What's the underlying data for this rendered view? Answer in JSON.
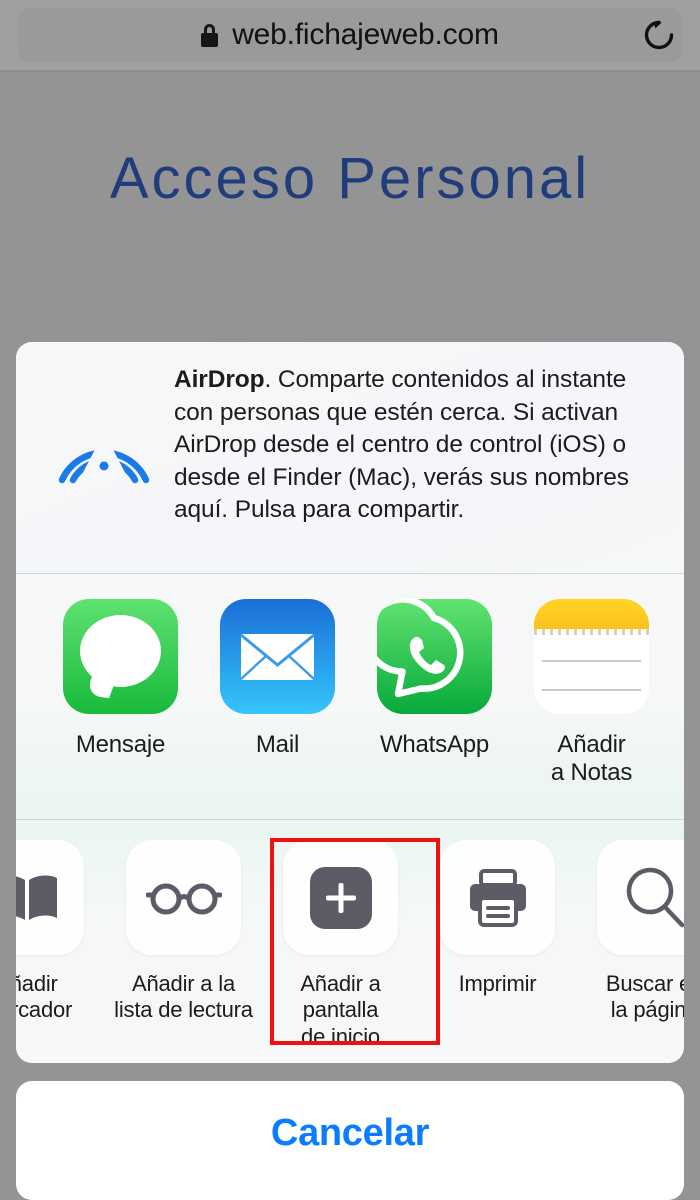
{
  "browser": {
    "url": "web.fichajeweb.com",
    "lock_icon": "lock-icon",
    "reload_icon": "reload-icon"
  },
  "page": {
    "title": "Acceso Personal",
    "title_color": "#1f3d7a",
    "backdrop_color": "#949494"
  },
  "share_sheet": {
    "airdrop": {
      "icon": "airdrop-icon",
      "icon_color": "#1a7ae8",
      "title": "AirDrop",
      "body": ". Comparte contenidos al instante con personas que estén cerca. Si activan AirDrop desde el centro de control (iOS) o desde el Finder (Mac), verás sus nombres aquí. Pulsa para compartir."
    },
    "apps": [
      {
        "label": "Mensaje",
        "icon": "messages-icon"
      },
      {
        "label": "Mail",
        "icon": "mail-icon"
      },
      {
        "label": "WhatsApp",
        "icon": "whatsapp-icon"
      },
      {
        "label": "Añadir\na Notas",
        "icon": "notes-icon"
      },
      {
        "label": "",
        "icon": "partial-app-icon"
      }
    ],
    "actions": [
      {
        "label": "Añadir\nmarcador",
        "icon": "book-icon",
        "highlighted": false
      },
      {
        "label": "Añadir a la\nlista de lectura",
        "icon": "glasses-icon",
        "highlighted": false
      },
      {
        "label": "Añadir a pantalla\nde inicio",
        "icon": "plus-icon",
        "highlighted": true
      },
      {
        "label": "Imprimir",
        "icon": "printer-icon",
        "highlighted": false
      },
      {
        "label": "Buscar en\nla página",
        "icon": "search-icon",
        "highlighted": false
      }
    ],
    "highlight_color": "#ee1111",
    "cancel_label": "Cancelar",
    "cancel_color": "#0a7cff"
  }
}
